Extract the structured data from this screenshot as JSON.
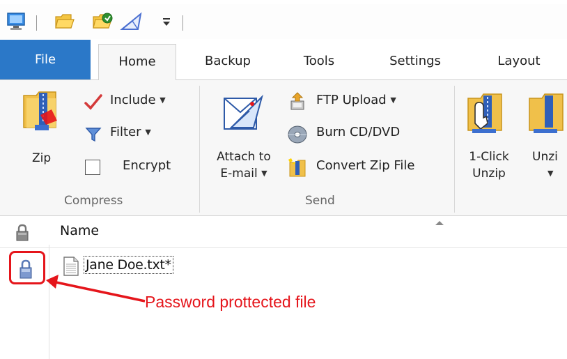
{
  "quick_access": {
    "icons": [
      "computer-monitor-icon",
      "open-folder-icon",
      "open-recent-icon",
      "wizard-icon",
      "customize-dropdown-icon"
    ]
  },
  "ribbon": {
    "tabs": [
      {
        "label": "File"
      },
      {
        "label": "Home"
      },
      {
        "label": "Backup"
      },
      {
        "label": "Tools"
      },
      {
        "label": "Settings"
      },
      {
        "label": "Layout"
      }
    ],
    "compress": {
      "group_label": "Compress",
      "zip_label": "Zip",
      "include_label": "Include",
      "filter_label": "Filter",
      "encrypt_label": "Encrypt"
    },
    "send": {
      "group_label": "Send",
      "attach_line1": "Attach to",
      "attach_line2": "E-mail",
      "ftp_label": "FTP Upload",
      "burn_label": "Burn CD/DVD",
      "convert_label": "Convert Zip File"
    },
    "unzip": {
      "one_click_line1": "1-Click",
      "one_click_line2": "Unzip",
      "unzip_label": "Unzi"
    }
  },
  "file_list": {
    "column_name": "Name",
    "files": [
      {
        "name": "Jane Doe.txt*",
        "encrypted": true
      }
    ]
  },
  "annotation": {
    "text": "Password prottected file",
    "color": "#e5151b"
  },
  "colors": {
    "file_tab": "#2b78c8",
    "ribbon_bg": "#f7f7f7"
  }
}
